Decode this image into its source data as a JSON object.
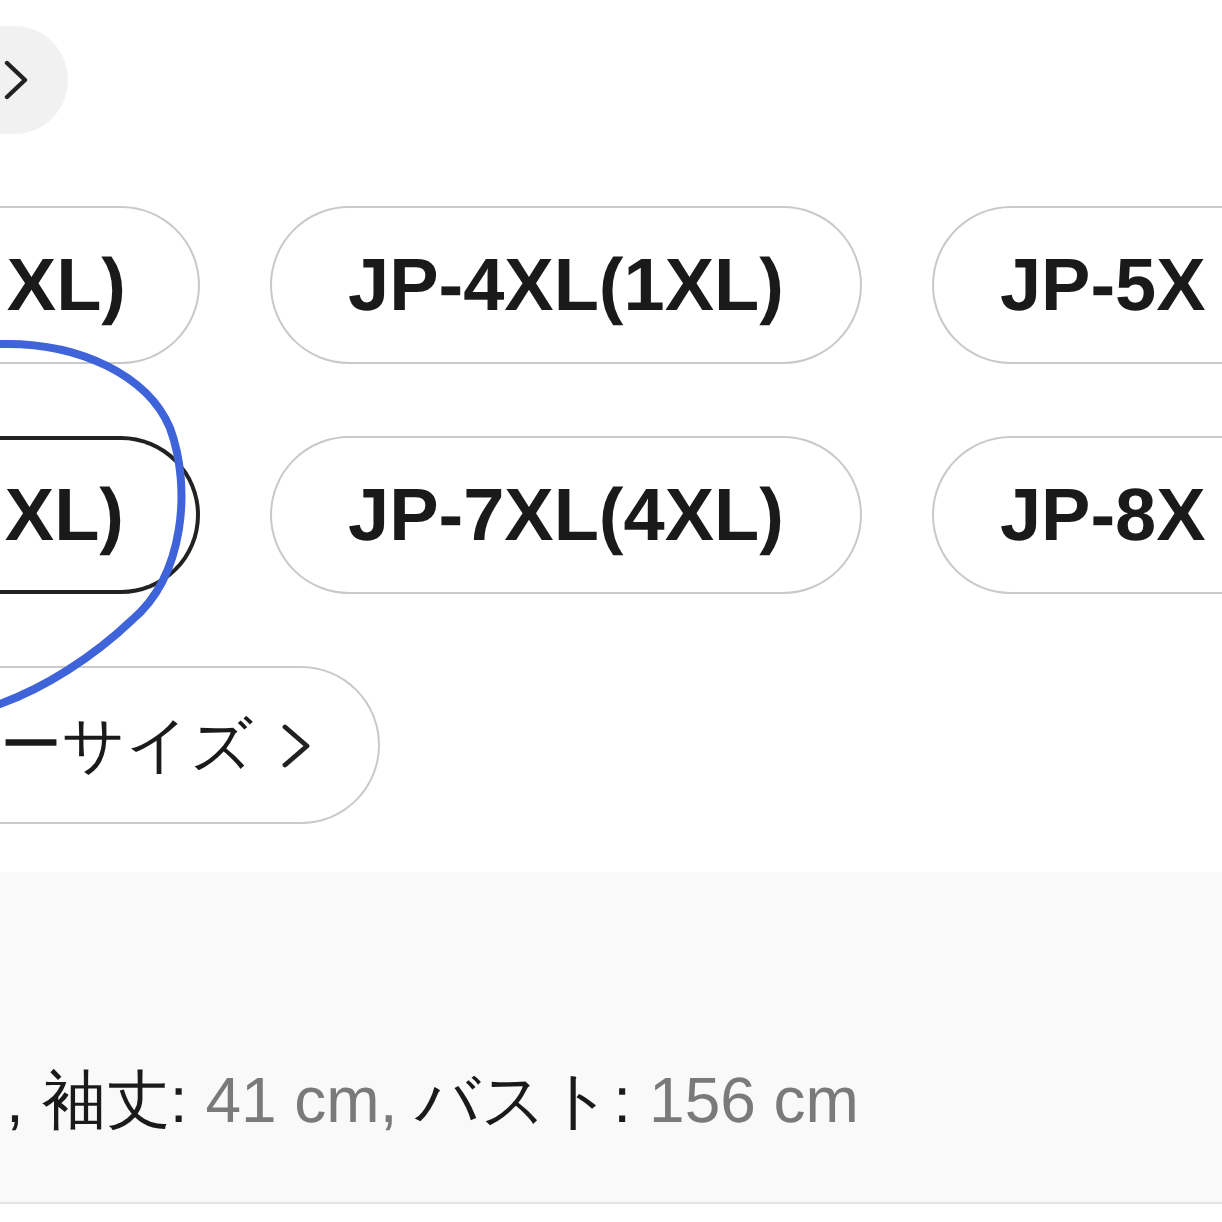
{
  "size_rows": [
    {
      "options": [
        {
          "label": "XL)",
          "selected": false
        },
        {
          "label": "JP-4XL(1XL)",
          "selected": false
        },
        {
          "label": "JP-5X",
          "selected": false
        }
      ]
    },
    {
      "options": [
        {
          "label": "XL)",
          "selected": true
        },
        {
          "label": "JP-7XL(4XL)",
          "selected": false
        },
        {
          "label": "JP-8X",
          "selected": false
        }
      ]
    }
  ],
  "more_sizes": {
    "label": "ーサイズ"
  },
  "measurements": {
    "lead": ",",
    "items": [
      {
        "label": "袖丈:",
        "value": "41 cm,"
      },
      {
        "label": "バスト:",
        "value": "156 cm"
      }
    ]
  }
}
